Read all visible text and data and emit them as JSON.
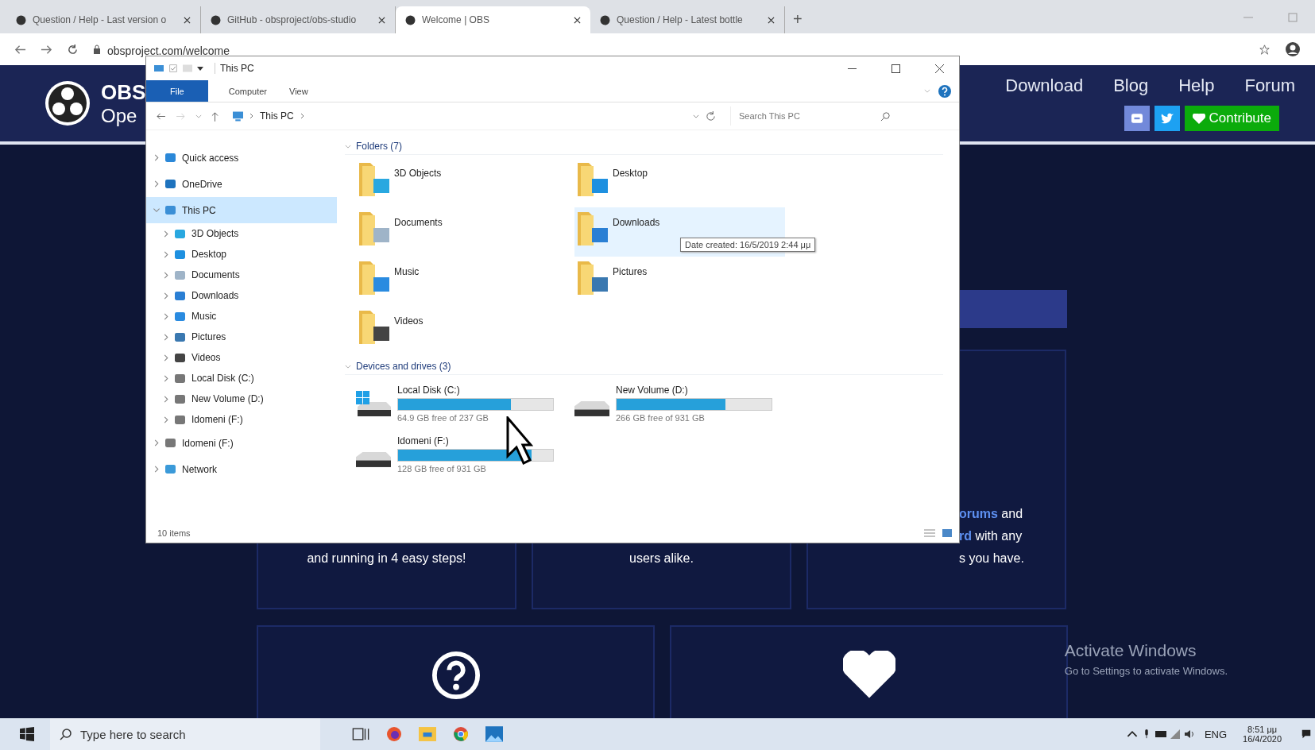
{
  "browser": {
    "tabs": [
      {
        "title": "Question / Help - Last version o",
        "selected": false
      },
      {
        "title": "GitHub - obsproject/obs-studio",
        "selected": false
      },
      {
        "title": "Welcome | OBS",
        "selected": true
      },
      {
        "title": "Question / Help - Latest bottle",
        "selected": false
      }
    ],
    "new_tab": "+",
    "url": "obsproject.com/welcome"
  },
  "site": {
    "logo_title": "OBS",
    "logo_subtitle": "Ope",
    "nav": [
      "Download",
      "Blog",
      "Help",
      "Forum"
    ],
    "contribute": "Contribute",
    "cards_row1": [
      {
        "lines": [
          {
            "text": "and running in 4 easy steps!"
          }
        ]
      },
      {
        "lines": [
          {
            "text": "users alike."
          }
        ]
      },
      {
        "lines": [
          {
            "link": "orums",
            "text": " and"
          },
          {
            "link": "rd",
            "text": " with any"
          },
          {
            "text": "s you have."
          }
        ]
      }
    ],
    "cards_row2": [
      {
        "kind": "question"
      },
      {
        "kind": "heart"
      }
    ]
  },
  "explorer": {
    "title": "This PC",
    "ribbon_tabs": [
      {
        "label": "File",
        "selected": true
      },
      {
        "label": "Computer",
        "selected": false
      },
      {
        "label": "View",
        "selected": false
      }
    ],
    "path": "This PC",
    "search_placeholder": "Search This PC",
    "nav": [
      {
        "label": "Quick access",
        "kind": "star",
        "expanded": false,
        "selected": false
      },
      {
        "label": "OneDrive",
        "kind": "cloud",
        "expanded": false,
        "selected": false
      },
      {
        "label": "This PC",
        "kind": "pc",
        "expanded": true,
        "selected": true,
        "children": [
          {
            "label": "3D Objects",
            "kind": "cube",
            "expanded": false,
            "selected": false
          },
          {
            "label": "Desktop",
            "kind": "desktop",
            "expanded": false,
            "selected": false
          },
          {
            "label": "Documents",
            "kind": "document",
            "expanded": false,
            "selected": false
          },
          {
            "label": "Downloads",
            "kind": "download",
            "expanded": false,
            "selected": false
          },
          {
            "label": "Music",
            "kind": "music",
            "expanded": false,
            "selected": false
          },
          {
            "label": "Pictures",
            "kind": "picture",
            "expanded": false,
            "selected": false
          },
          {
            "label": "Videos",
            "kind": "video",
            "expanded": false,
            "selected": false
          },
          {
            "label": "Local Disk (C:)",
            "kind": "drive",
            "expanded": false,
            "selected": false
          },
          {
            "label": "New Volume (D:)",
            "kind": "drive",
            "expanded": false,
            "selected": false
          },
          {
            "label": "Idomeni (F:)",
            "kind": "drive",
            "expanded": false,
            "selected": false
          }
        ]
      },
      {
        "label": "Idomeni (F:)",
        "kind": "drive",
        "expanded": false,
        "selected": false
      },
      {
        "label": "Network",
        "kind": "network",
        "expanded": false,
        "selected": false
      }
    ],
    "folders_header": "Folders (7)",
    "folders": [
      {
        "name": "3D Objects",
        "kind": "cube",
        "selected": false
      },
      {
        "name": "Desktop",
        "kind": "desktop",
        "selected": false
      },
      {
        "name": "Documents",
        "kind": "document",
        "selected": false
      },
      {
        "name": "Downloads",
        "kind": "download",
        "selected": true
      },
      {
        "name": "Music",
        "kind": "music",
        "selected": false
      },
      {
        "name": "Pictures",
        "kind": "picture",
        "selected": false
      },
      {
        "name": "Videos",
        "kind": "video",
        "selected": false
      }
    ],
    "tooltip": "Date created: 16/5/2019 2:44 μμ",
    "drives_header": "Devices and drives (3)",
    "drives": [
      {
        "name": "Local Disk (C:)",
        "kind": "system",
        "level": 0.73,
        "free": "64.9 GB free of 237 GB"
      },
      {
        "name": "New Volume (D:)",
        "kind": "data",
        "level": 0.7,
        "free": "266 GB free of 931 GB"
      },
      {
        "name": "Idomeni (F:)",
        "kind": "data",
        "level": 0.86,
        "free": "128 GB free of 931 GB"
      }
    ],
    "status": "10 items"
  },
  "activation": {
    "title": "Activate Windows",
    "text": "Go to Settings to activate Windows."
  },
  "taskbar": {
    "search_placeholder": "Type here to search",
    "language": "ENG",
    "time": "8:51 μμ",
    "date": "16/4/2020"
  }
}
